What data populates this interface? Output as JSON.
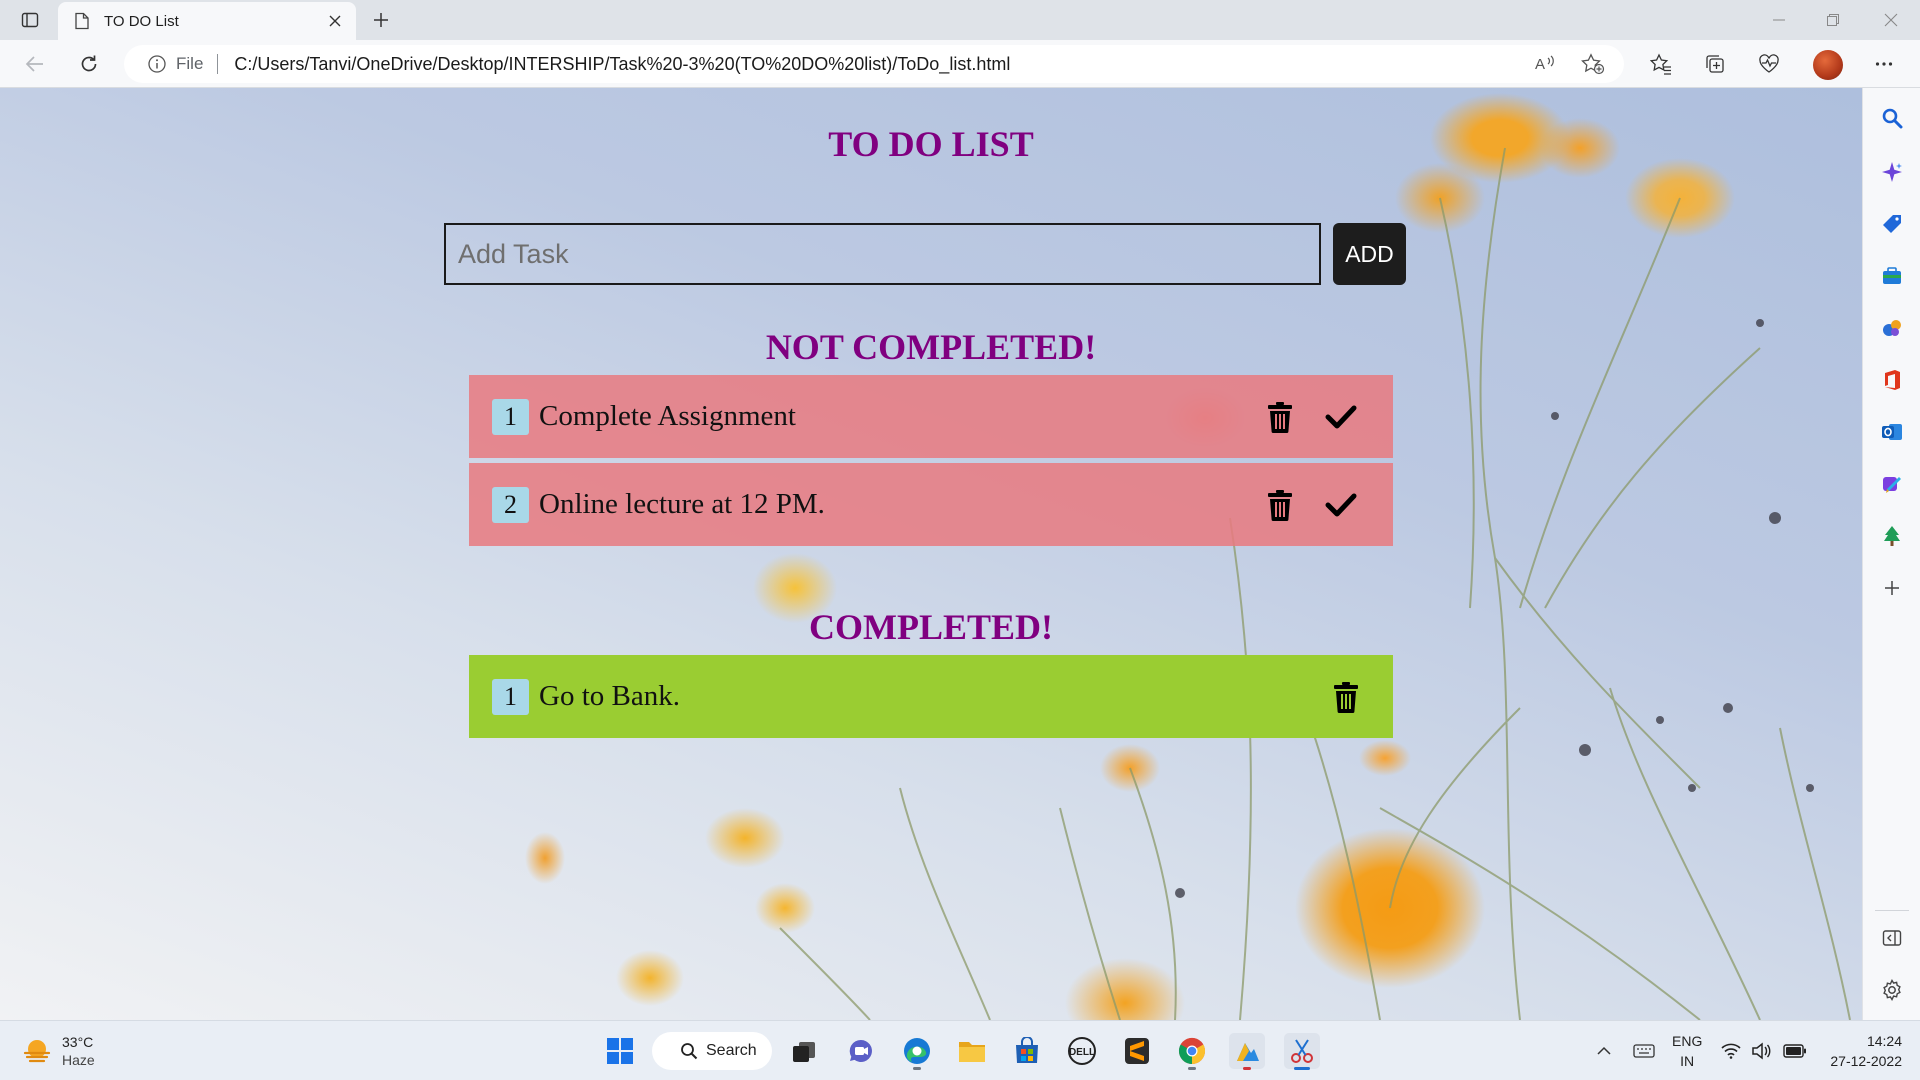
{
  "browser": {
    "tab_title": "TO DO List",
    "address_scheme": "File",
    "address_url": "C:/Users/Tanvi/OneDrive/Desktop/INTERSHIP/Task%20-3%20(TO%20DO%20list)/ToDo_list.html",
    "accent_color": "#0078d4"
  },
  "app": {
    "title": "TO DO LIST",
    "input_placeholder": "Add Task",
    "input_value": "",
    "add_label": "ADD",
    "not_completed_heading": "NOT COMPLETED!",
    "completed_heading": "COMPLETED!",
    "pending_color": "#e87a80",
    "done_color": "#9acd32",
    "heading_color": "#800080",
    "not_completed": [
      {
        "number": "1",
        "text": "Complete Assignment"
      },
      {
        "number": "2",
        "text": "Online lecture at 12 PM."
      }
    ],
    "completed": [
      {
        "number": "1",
        "text": "Go to Bank."
      }
    ]
  },
  "taskbar": {
    "weather_temp": "33°C",
    "weather_condition": "Haze",
    "search_label": "Search",
    "lang_line1": "ENG",
    "lang_line2": "IN",
    "time": "14:24",
    "date": "27-12-2022"
  }
}
